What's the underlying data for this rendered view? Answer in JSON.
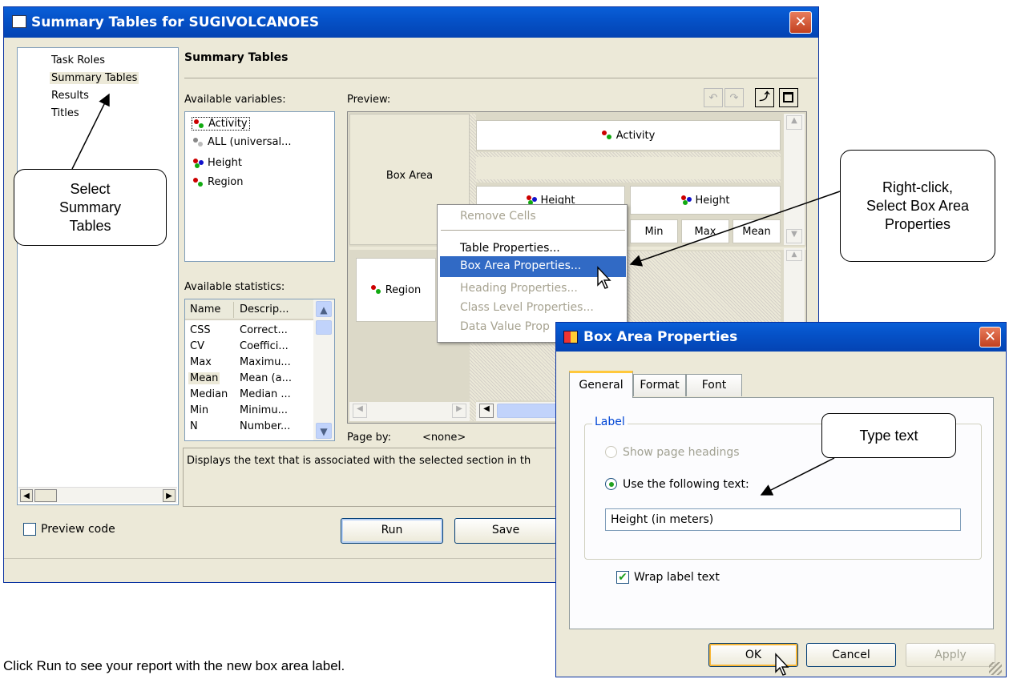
{
  "main_window": {
    "title": "Summary Tables for SUGIVOLCANOES",
    "nav": [
      "Task Roles",
      "Summary Tables",
      "Results",
      "Titles"
    ],
    "section_title": "Summary Tables",
    "available_variables_label": "Available variables:",
    "variables": [
      "Activity",
      "ALL (universal...",
      "Height",
      "Region"
    ],
    "available_statistics_label": "Available statistics:",
    "stats_columns": [
      "Name",
      "Descrip..."
    ],
    "stats": [
      {
        "name": "CSS",
        "desc": "Correct..."
      },
      {
        "name": "CV",
        "desc": "Coeffici..."
      },
      {
        "name": "Max",
        "desc": "Maximu..."
      },
      {
        "name": "Mean",
        "desc": "Mean (a..."
      },
      {
        "name": "Median",
        "desc": "Median ..."
      },
      {
        "name": "Min",
        "desc": "Minimu..."
      },
      {
        "name": "N",
        "desc": "Number..."
      }
    ],
    "preview_label": "Preview:",
    "preview": {
      "box_area": "Box Area",
      "activity": "Activity",
      "height1": "Height",
      "height2": "Height",
      "min": "Min",
      "max": "Max",
      "mean": "Mean",
      "region": "Region"
    },
    "page_by_label": "Page by:",
    "page_by_value": "<none>",
    "description": "Displays the text that is associated with the selected section in th",
    "preview_code_label": "Preview code",
    "run_label": "Run",
    "save_label": "Save"
  },
  "context_menu": {
    "items": [
      "Remove Cells",
      "Table Properties...",
      "Box Area Properties...",
      "Heading Properties...",
      "Class Level Properties...",
      "Data Value Prop"
    ]
  },
  "dialog": {
    "title": "Box Area Properties",
    "tabs": [
      "General",
      "Format",
      "Font"
    ],
    "group_label": "Label",
    "radio_page_headings": "Show page headings",
    "radio_following_text": "Use the following text:",
    "text_value": "Height (in meters)",
    "wrap_label": "Wrap label text",
    "ok_label": "OK",
    "cancel_label": "Cancel",
    "apply_label": "Apply"
  },
  "callouts": {
    "select_summary": "Select Summary Tables",
    "right_click": "Right-click, Select Box Area Properties",
    "type_text": "Type text"
  },
  "caption": "Click Run to see your report with the new box area label."
}
